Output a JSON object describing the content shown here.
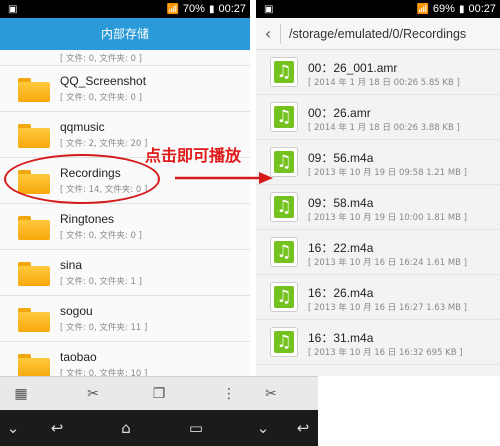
{
  "left": {
    "status": {
      "battery": "70%",
      "time": "00:27"
    },
    "header_title": "内部存储",
    "first_partial_sub": "[ 文件: 0, 文件夹: 0 ]",
    "folders": [
      {
        "name": "QQ_Screenshot",
        "sub": "[ 文件: 0, 文件夹: 0 ]"
      },
      {
        "name": "qqmusic",
        "sub": "[ 文件: 2, 文件夹: 20 ]"
      },
      {
        "name": "Recordings",
        "sub": "[ 文件: 14, 文件夹: 0 ]"
      },
      {
        "name": "Ringtones",
        "sub": "[ 文件: 0, 文件夹: 0 ]"
      },
      {
        "name": "sina",
        "sub": "[ 文件: 0, 文件夹: 1 ]"
      },
      {
        "name": "sogou",
        "sub": "[ 文件: 0, 文件夹: 11 ]"
      },
      {
        "name": "taobao",
        "sub": "[ 文件: 0, 文件夹: 10 ]"
      }
    ]
  },
  "right": {
    "status": {
      "battery": "69%",
      "time": "00:27"
    },
    "path": "/storage/emulated/0/Recordings",
    "files": [
      {
        "name": "00：26_001.amr",
        "sub": "[ 2014 年 1 月 18 日 00:26 5.85 KB ]"
      },
      {
        "name": "00：26.amr",
        "sub": "[ 2014 年 1 月 18 日 00:26 3.88 KB ]"
      },
      {
        "name": "09：56.m4a",
        "sub": "[ 2013 年 10 月 19 日 09:58 1.21 MB ]"
      },
      {
        "name": "09：58.m4a",
        "sub": "[ 2013 年 10 月 19 日 10:00 1.81 MB ]"
      },
      {
        "name": "16：22.m4a",
        "sub": "[ 2013 年 10 月 16 日 16:24 1.61 MB ]"
      },
      {
        "name": "16：26.m4a",
        "sub": "[ 2013 年 10 月 16 日 16:27 1.63 MB ]"
      },
      {
        "name": "16：31.m4a",
        "sub": "[ 2013 年 10 月 16 日 16:32 695 KB ]"
      }
    ]
  },
  "annotation": "点击即可播放",
  "colors": {
    "header": "#2a9ad9",
    "annotation": "#e01818",
    "music_green": "#74c21d",
    "folder": "#f7a80c"
  }
}
